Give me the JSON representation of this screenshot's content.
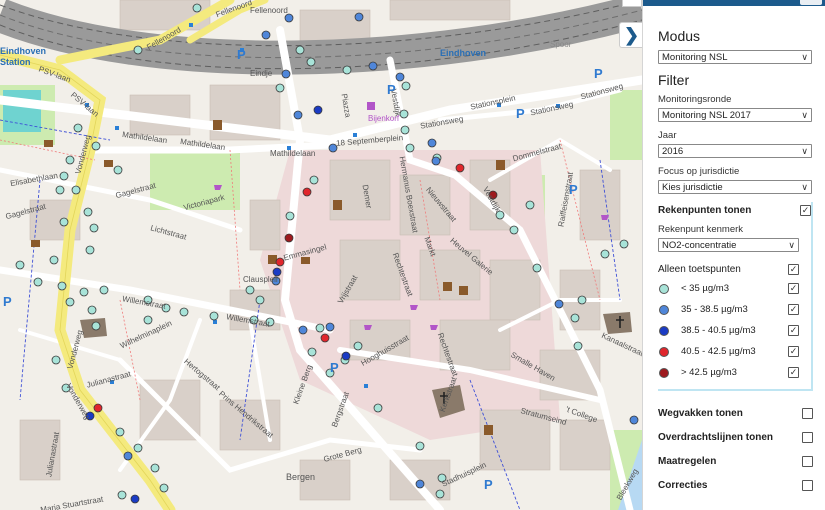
{
  "map": {
    "street_labels": {
      "fellenoord1": "Fellenoord",
      "fellenoord2": "Fellenoord",
      "fellenoord3": "Fellenoord",
      "psv1": "PSV-laan",
      "psv2": "PSV-laan",
      "vonderweg1": "Vonderweg",
      "vonderweg2": "Vonderweg",
      "mathildelaan1": "Mathildelaan",
      "mathildelaan2": "Mathildelaan",
      "mathildelaan3": "Mathildelaan",
      "sept": "18 Septemberplein",
      "stationsweg1": "Stationsweg",
      "stationsweg2": "Stationsweg",
      "stationsplein": "Stationsplein",
      "vestdijk1": "Vestdijk",
      "vestdijk2": "Vestdijk",
      "dommelstraat": "Dommelstraat",
      "elisabeth": "Elisabethlaan",
      "gagelstraat1": "Gagelstraat",
      "gagelstraat2": "Gagelstraat",
      "victoria": "Victoriapark",
      "lichtstraat": "Lichtstraat",
      "willem1": "Willemstraat",
      "willem2": "Willemstraat",
      "wilhelmina": "Wilhelminaplein",
      "clausplein": "Clausplein",
      "emmasingel": "Emmasingel",
      "vrijstraat": "Vrijstraat",
      "rechtestraat1": "Rechtestraat",
      "rechtestraat2": "Rechtestraat",
      "markt": "Markt",
      "demer": "Demer",
      "hermanbos": "Hermanus Boexstraat",
      "nieuwstraat": "Nieuwstraat",
      "heuvel": "Heuvel Galerie",
      "hoogstraat": "Hooghuisstraat",
      "bergstraat": "Bergstraat",
      "smallehaven": "Smalle Haven",
      "stratumseind": "Stratumseind",
      "college": "'t College",
      "kanaalstraat": "Kanaalstraat",
      "grote_berg": "Grote Berg",
      "bergen": "Bergen",
      "stadhuisplein": "Stadhuisplein",
      "juliana1": "Julianastraat",
      "juliana2": "Julianastraat",
      "maria": "Maria Stuartstraat",
      "raiffeisen": "Raiffeisenstraat",
      "eindje": "Eindje",
      "piazza": "Piazza",
      "bijenkorf": "Bijenkorf",
      "kerkstraat": "Kerkstraat",
      "bleekweg": "Bleekweg",
      "vonderweg3": "Vonderweg",
      "kleineberg": "Kleine Berg",
      "prinshendrik": "Prins Hendrikstraat",
      "hertogstraat": "Hertogstraat",
      "stationsweg3": "Stationsweg"
    },
    "place_labels": {
      "eindhoven_left": "Eindhoven",
      "station_left": "Station",
      "eindhoven_right": "Eindhoven",
      "spoor": "Spoor"
    },
    "parking_symbol": "P",
    "collapse_icon": "chevron-right-icon"
  },
  "panel": {
    "modus_heading": "Modus",
    "modus_value": "Monitoring NSL",
    "filter_heading": "Filter",
    "ronde_label": "Monitoringsronde",
    "ronde_value": "Monitoring NSL 2017",
    "jaar_label": "Jaar",
    "jaar_value": "2016",
    "focus_label": "Focus op jurisdictie",
    "focus_value": "Kies jurisdictie",
    "rekenpunten_label": "Rekenpunten tonen",
    "rekenpunten_checked": true,
    "kenmerk_label": "Rekenpunt kenmerk",
    "kenmerk_value": "NO2-concentratie",
    "toetspunten_label": "Alleen toetspunten",
    "toetspunten_checked": true,
    "legend": [
      {
        "label": "< 35 µg/m3",
        "color": "#a8e3d8",
        "checked": true
      },
      {
        "label": "35 - 38.5 µg/m3",
        "color": "#4f86d9",
        "checked": true
      },
      {
        "label": "38.5 - 40.5 µg/m3",
        "color": "#1b3bc4",
        "checked": true
      },
      {
        "label": "40.5 - 42.5 µg/m3",
        "color": "#e0262c",
        "checked": true
      },
      {
        "label": "> 42.5 µg/m3",
        "color": "#9e1a1e",
        "checked": true
      }
    ],
    "wegvakken_label": "Wegvakken tonen",
    "overdracht_label": "Overdrachtslijnen tonen",
    "maatregelen_label": "Maatregelen",
    "correcties_label": "Correcties",
    "check_mark": "✓"
  }
}
